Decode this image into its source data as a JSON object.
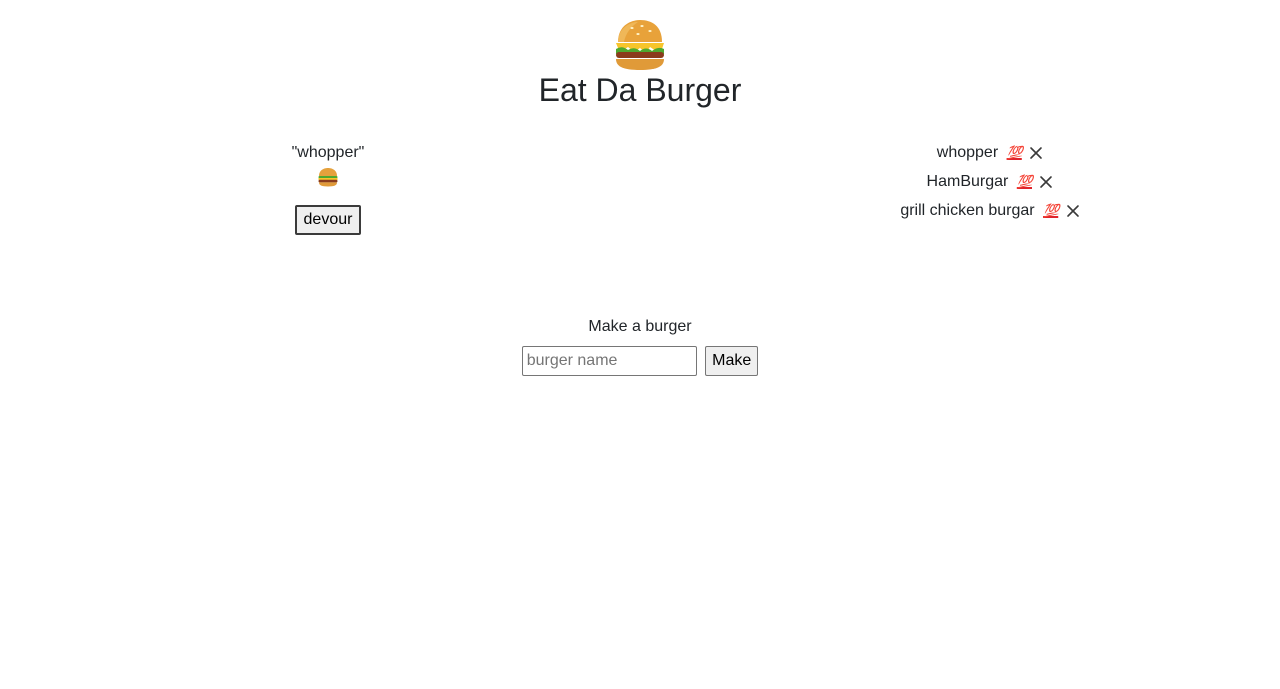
{
  "header": {
    "logo_icon": "burger-icon",
    "title": "Eat Da Burger"
  },
  "uneaten": {
    "items": [
      {
        "name": "\"whopper\"",
        "icon": "burger-icon",
        "button_label": "devour"
      }
    ]
  },
  "eaten": {
    "items": [
      {
        "name": "whopper",
        "badge": "💯",
        "delete_icon": "close-icon"
      },
      {
        "name": "HamBurgar",
        "badge": "💯",
        "delete_icon": "close-icon"
      },
      {
        "name": "grill chicken burgar",
        "badge": "💯",
        "delete_icon": "close-icon"
      }
    ]
  },
  "make": {
    "label": "Make a burger",
    "input_value": "",
    "input_placeholder": "burger name",
    "button_label": "Make"
  },
  "colors": {
    "text": "#212529",
    "hundred_red": "#e0242b",
    "button_bg": "#efefef"
  }
}
